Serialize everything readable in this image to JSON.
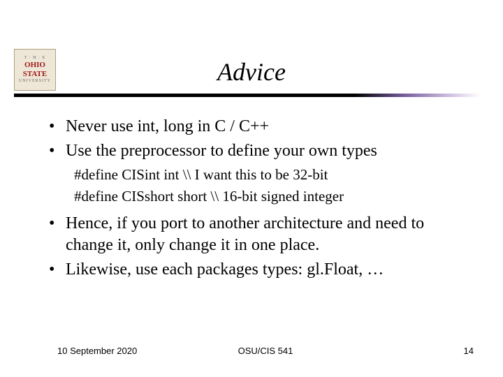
{
  "logo": {
    "line1": "T · H · E",
    "line2": "OHIO",
    "line3": "STATE",
    "line4": "UNIVERSITY"
  },
  "title": "Advice",
  "bullets": [
    {
      "text": "Never use int, long in C / C++"
    },
    {
      "text": "Use the preprocessor to define your own types"
    }
  ],
  "subitems": [
    "#define CISint  int  \\\\ I want this to be 32-bit",
    "#define CISshort  short  \\\\ 16-bit signed integer"
  ],
  "bullets2": [
    {
      "text": "Hence, if you port to another architecture and need to change it, only change it in one place."
    },
    {
      "text": "Likewise, use each packages types: gl.Float, …"
    }
  ],
  "footer": {
    "date": "10 September 2020",
    "course": "OSU/CIS 541",
    "page": "14"
  }
}
